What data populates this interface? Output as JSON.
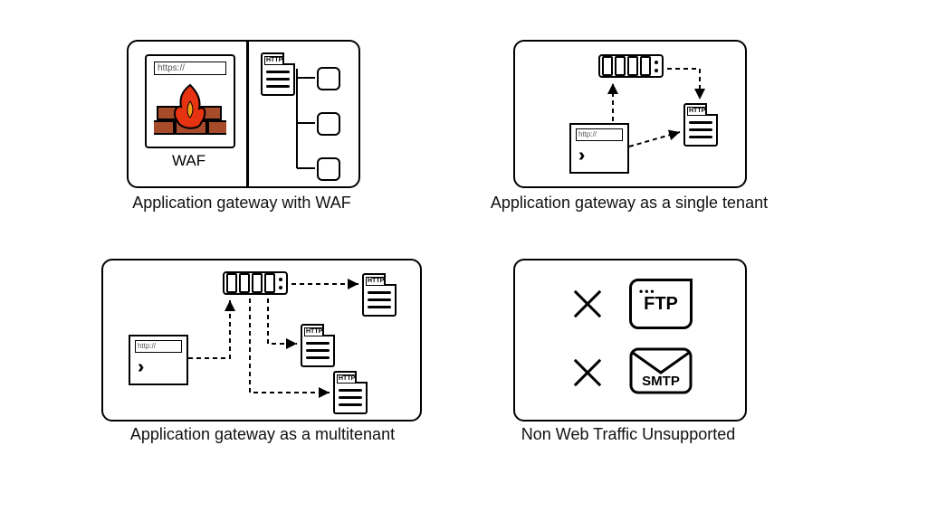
{
  "diagrams": {
    "waf": {
      "caption": "Application gateway with WAF",
      "waf_label": "WAF",
      "url_label": "https://",
      "doc_label": "HTTP"
    },
    "single": {
      "caption": "Application gateway as a single tenant",
      "url_label": "http://",
      "doc_label": "HTTP"
    },
    "multi": {
      "caption": "Application gateway as a multitenant",
      "url_label": "http://",
      "doc_label": "HTTP"
    },
    "nonweb": {
      "caption": "Non Web Traffic Unsupported",
      "proto1": "FTP",
      "proto2": "SMTP"
    }
  },
  "icons": {
    "firewall_color": "#a84b2a",
    "flame_color": "#e63312"
  }
}
